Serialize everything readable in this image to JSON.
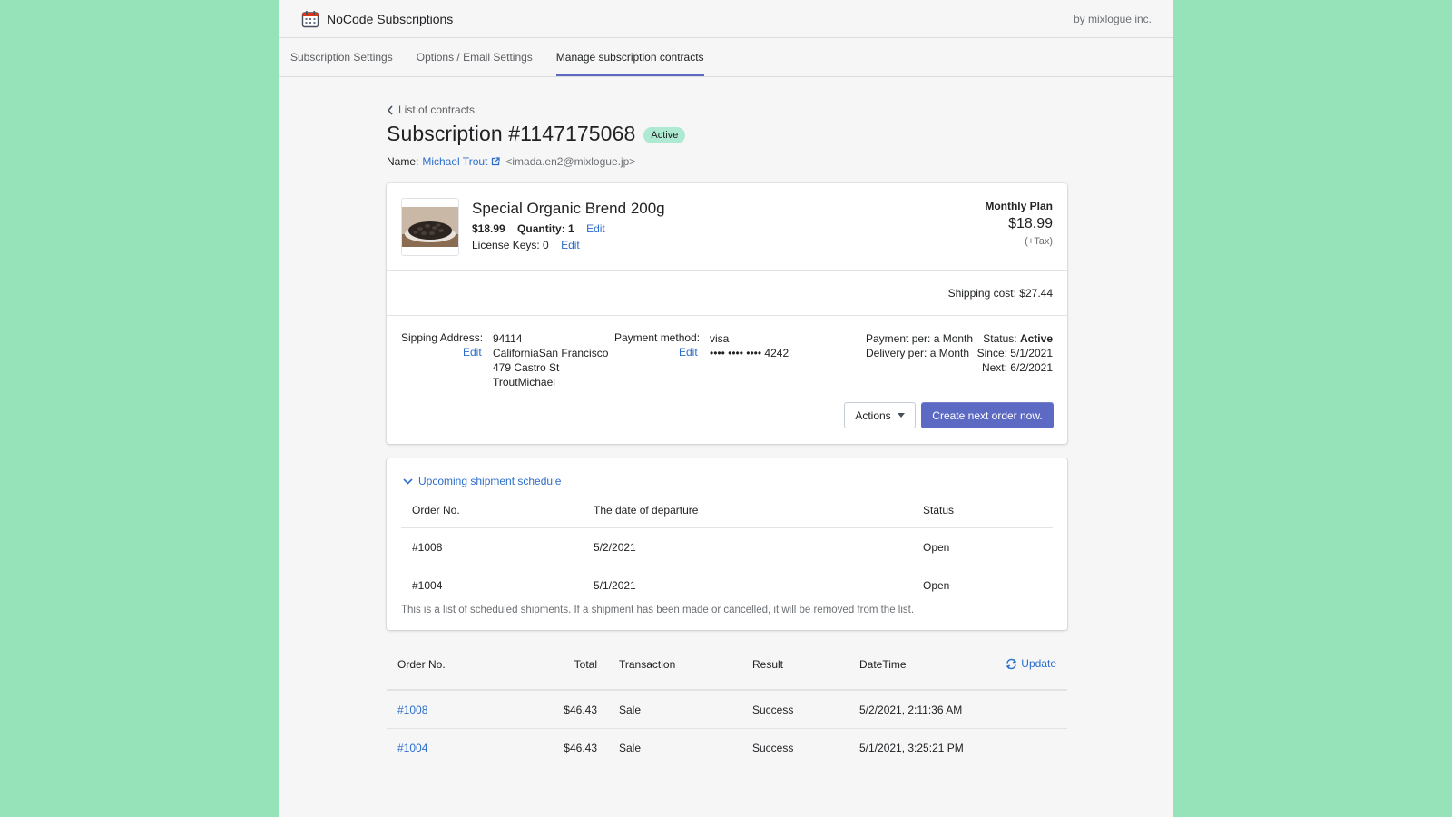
{
  "app": {
    "title": "NoCode Subscriptions",
    "by": "by mixlogue inc."
  },
  "tabs": [
    {
      "label": "Subscription Settings"
    },
    {
      "label": "Options / Email Settings"
    },
    {
      "label": "Manage subscription contracts"
    }
  ],
  "back_label": "List of contracts",
  "subscription": {
    "title": "Subscription #1147175068",
    "status_badge": "Active",
    "name_label": "Name:",
    "customer_name": "Michael Trout",
    "customer_email": "<imada.en2@mixlogue.jp>"
  },
  "product": {
    "name": "Special Organic Brend 200g",
    "price": "$18.99",
    "quantity_label": "Quantity: 1",
    "license_label": "License Keys: 0",
    "edit_label": "Edit",
    "plan_name": "Monthly Plan",
    "plan_price": "$18.99",
    "plan_tax": "(+Tax)"
  },
  "shipping_cost": "Shipping cost: $27.44",
  "details": {
    "address_label": "Sipping Address:",
    "address_lines": [
      "94114",
      "CaliforniaSan Francisco",
      "479 Castro St",
      "TroutMichael"
    ],
    "edit_label": "Edit",
    "payment_label": "Payment method:",
    "payment_lines": [
      "visa",
      "•••• •••• •••• 4242"
    ],
    "payment_per": "Payment per: a Month",
    "delivery_per": "Delivery per: a Month",
    "status_label": "Status:",
    "status_value": "Active",
    "since": "Since: 5/1/2021",
    "next": "Next: 6/2/2021",
    "actions_label": "Actions",
    "create_label": "Create next order now."
  },
  "schedule": {
    "toggle_label": "Upcoming shipment schedule",
    "headers": [
      "Order No.",
      "The date of departure",
      "Status"
    ],
    "rows": [
      [
        "#1008",
        "5/2/2021",
        "Open"
      ],
      [
        "#1004",
        "5/1/2021",
        "Open"
      ]
    ],
    "note": "This is a list of scheduled shipments. If a shipment has been made or cancelled, it will be removed from the list."
  },
  "orders": {
    "headers": [
      "Order No.",
      "Total",
      "Transaction",
      "Result",
      "DateTime"
    ],
    "update_label": "Update",
    "rows": [
      [
        "#1008",
        "$46.43",
        "Sale",
        "Success",
        "5/2/2021, 2:11:36 AM"
      ],
      [
        "#1004",
        "$46.43",
        "Sale",
        "Success",
        "5/1/2021, 3:25:21 PM"
      ]
    ]
  },
  "colors": {
    "background": "#97e3b9",
    "accent": "#5c6ac4",
    "link": "#2c6ecb",
    "badge": "#aee9d1"
  }
}
